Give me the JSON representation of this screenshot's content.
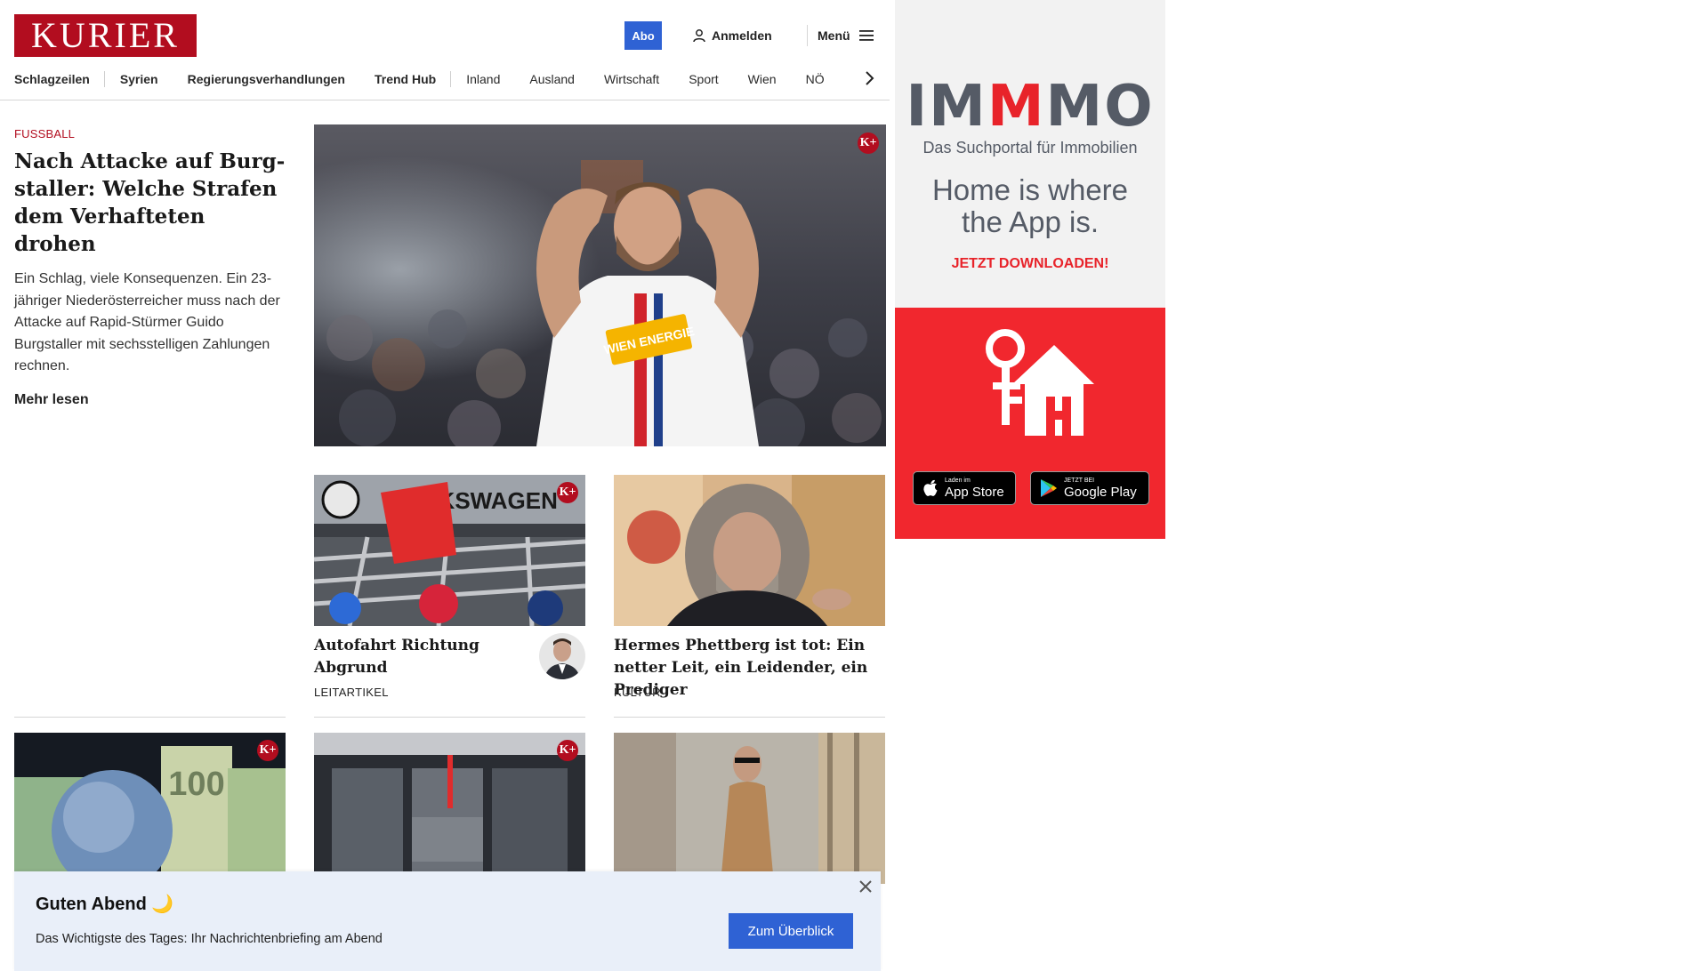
{
  "header": {
    "logo_text": "KURIER",
    "abo_label": "Abo",
    "login_label": "Anmelden",
    "menu_label": "Menü"
  },
  "nav": {
    "items": [
      "Schlagzeilen",
      "Syrien",
      "Regierungsverhandlungen",
      "Trend Hub",
      "Inland",
      "Ausland",
      "Wirtschaft",
      "Sport",
      "Wien",
      "NÖ"
    ]
  },
  "lead": {
    "kicker": "FUSSBALL",
    "title": "Nach Attacke auf Burg-staller: Welche Strafen dem Verhafteten drohen",
    "teaser": "Ein Schlag, viele Konsequenzen. Ein 23-jähriger Niederösterreicher muss nach der Attacke auf Rapid-Stürmer Guido Burgstaller mit sechsstelligen Zahlungen rechnen.",
    "more_label": "Mehr lesen",
    "jersey_text": "WIEN ENERGIE"
  },
  "badges": {
    "kplus": "K+"
  },
  "cards": [
    {
      "title": "Autofahrt Richtung Abgrund",
      "label": "LEITARTIKEL",
      "image_text": "VOLKSWAGEN"
    },
    {
      "title": "Hermes Phettberg ist tot: Ein netter Leit, ein Leidender, ein Prediger",
      "label": "KULTUR"
    }
  ],
  "row3": [
    {
      "image_text": "100"
    },
    {
      "image_text": ""
    },
    {
      "image_text": ""
    }
  ],
  "ad": {
    "brand_parts": [
      "IM",
      "M",
      "MO"
    ],
    "subtitle": "Das Suchportal für Immobilien",
    "tagline_1": "Home is where",
    "tagline_2": "the App is.",
    "cta": "JETZT DOWNLOADEN!",
    "appstore_small": "Laden im",
    "appstore_big": "App Store",
    "gplay_small": "JETZT BEI",
    "gplay_big": "Google Play"
  },
  "banner": {
    "title": "Guten Abend 🌙",
    "text": "Das Wichtigste des Tages: Ihr Nachrichtenbriefing am Abend",
    "button": "Zum Überblick"
  },
  "colors": {
    "brand_red": "#b20d1f",
    "accent_blue": "#2f62d4",
    "ad_red": "#f1272e",
    "ad_grey": "#555b66"
  }
}
